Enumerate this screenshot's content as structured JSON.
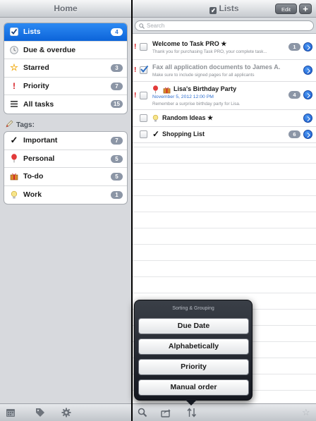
{
  "left": {
    "title": "Home",
    "lists": [
      {
        "label": "Lists",
        "badge": "4",
        "icon": "check-icon",
        "selected": true
      },
      {
        "label": "Due & overdue",
        "badge": "",
        "icon": "clock-icon"
      },
      {
        "label": "Starred",
        "badge": "3",
        "icon": "star-icon"
      },
      {
        "label": "Priority",
        "badge": "7",
        "icon": "exclamation-icon"
      },
      {
        "label": "All tasks",
        "badge": "15",
        "icon": "lines-icon"
      }
    ],
    "tags_label": "Tags:",
    "tags": [
      {
        "label": "Important",
        "badge": "7",
        "icon": "checkmark-icon"
      },
      {
        "label": "Personal",
        "badge": "5",
        "icon": "balloon-icon"
      },
      {
        "label": "To-do",
        "badge": "5",
        "icon": "gift-icon"
      },
      {
        "label": "Work",
        "badge": "1",
        "icon": "lightbulb-icon"
      }
    ]
  },
  "right": {
    "title": "Lists",
    "edit_label": "Edit",
    "add_label": "+",
    "search_placeholder": "Search",
    "tasks": [
      {
        "title": "Welcome to Task PRO ★",
        "subtitle": "Thank you for purchasing Task PRO, your complete task...",
        "priority": "!",
        "count": "1",
        "checked": false
      },
      {
        "title": "Fax all application documents to James A.",
        "subtitle": "Make sure to include signed pages for all applicants",
        "priority": "!",
        "count": "",
        "checked": true
      },
      {
        "title": "Lisa's Birthday Party",
        "date": "November 5, 2012 12:00 PM",
        "subtitle": "Remember a surprise birthday party for Lisa.",
        "priority": "!",
        "count": "4",
        "checked": false
      },
      {
        "title": "Random Ideas ★",
        "priority": "",
        "count": "",
        "checked": false
      },
      {
        "title": "Shopping List",
        "priority": "",
        "count": "6",
        "checked": false
      }
    ]
  },
  "popover": {
    "title": "Sorting & Grouping",
    "options": [
      "Due Date",
      "Alphabetically",
      "Priority",
      "Manual order"
    ]
  },
  "colors": {
    "accent": "#1a73e8",
    "priority": "#d5151b",
    "badge": "#8c96a6"
  }
}
